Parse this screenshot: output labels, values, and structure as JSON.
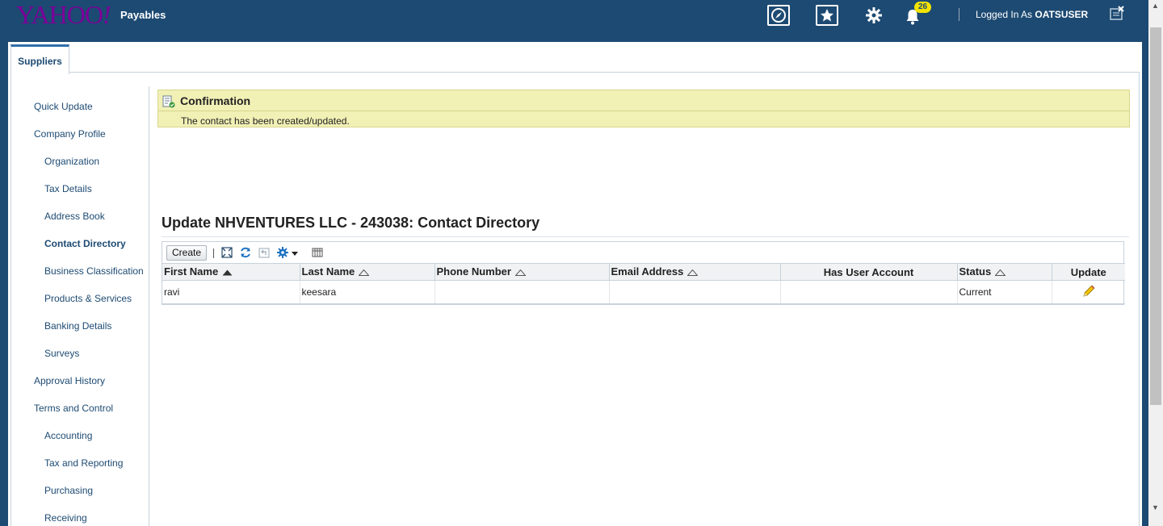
{
  "header": {
    "logo_text": "YAHOO",
    "logo_bang": "!",
    "app_name": "Payables",
    "icons": [
      "compass-icon",
      "favorites-star-icon",
      "settings-gear-icon",
      "notifications-bell-icon"
    ],
    "notification_count": "26",
    "logged_in_prefix": "Logged In As",
    "username": "OATSUSER",
    "accent_color": "#1d4a72",
    "logo_color": "#7b0099"
  },
  "tabs": [
    {
      "label": "Suppliers"
    }
  ],
  "sidenav": {
    "items": [
      {
        "label": "Quick Update",
        "level": 1
      },
      {
        "label": "Company Profile",
        "level": 1
      },
      {
        "label": "Organization",
        "level": 2
      },
      {
        "label": "Tax Details",
        "level": 2
      },
      {
        "label": "Address Book",
        "level": 2
      },
      {
        "label": "Contact Directory",
        "level": 2,
        "active": true
      },
      {
        "label": "Business Classification",
        "level": 2
      },
      {
        "label": "Products & Services",
        "level": 2
      },
      {
        "label": "Banking Details",
        "level": 2
      },
      {
        "label": "Surveys",
        "level": 2
      },
      {
        "label": "Approval History",
        "level": 1
      },
      {
        "label": "Terms and Control",
        "level": 1
      },
      {
        "label": "Accounting",
        "level": 2
      },
      {
        "label": "Tax and Reporting",
        "level": 2
      },
      {
        "label": "Purchasing",
        "level": 2
      },
      {
        "label": "Receiving",
        "level": 2
      }
    ]
  },
  "confirmation": {
    "title": "Confirmation",
    "message": "The contact has been created/updated.",
    "bg_color": "#f1f0b5"
  },
  "page": {
    "title": "Update NHVENTURES LLC - 243038: Contact Directory"
  },
  "toolbar": {
    "create_label": "Create",
    "icons": [
      "detach-icon",
      "refresh-icon",
      "undo-icon",
      "settings-menu-icon",
      "columns-icon"
    ]
  },
  "table": {
    "columns": [
      "First Name",
      "Last Name",
      "Phone Number",
      "Email Address",
      "Has User Account",
      "Status",
      "Update"
    ],
    "rows": [
      {
        "first_name": "ravi",
        "last_name": "keesara",
        "phone": "",
        "email": "",
        "has_user_account": "",
        "status": "Current"
      }
    ]
  }
}
